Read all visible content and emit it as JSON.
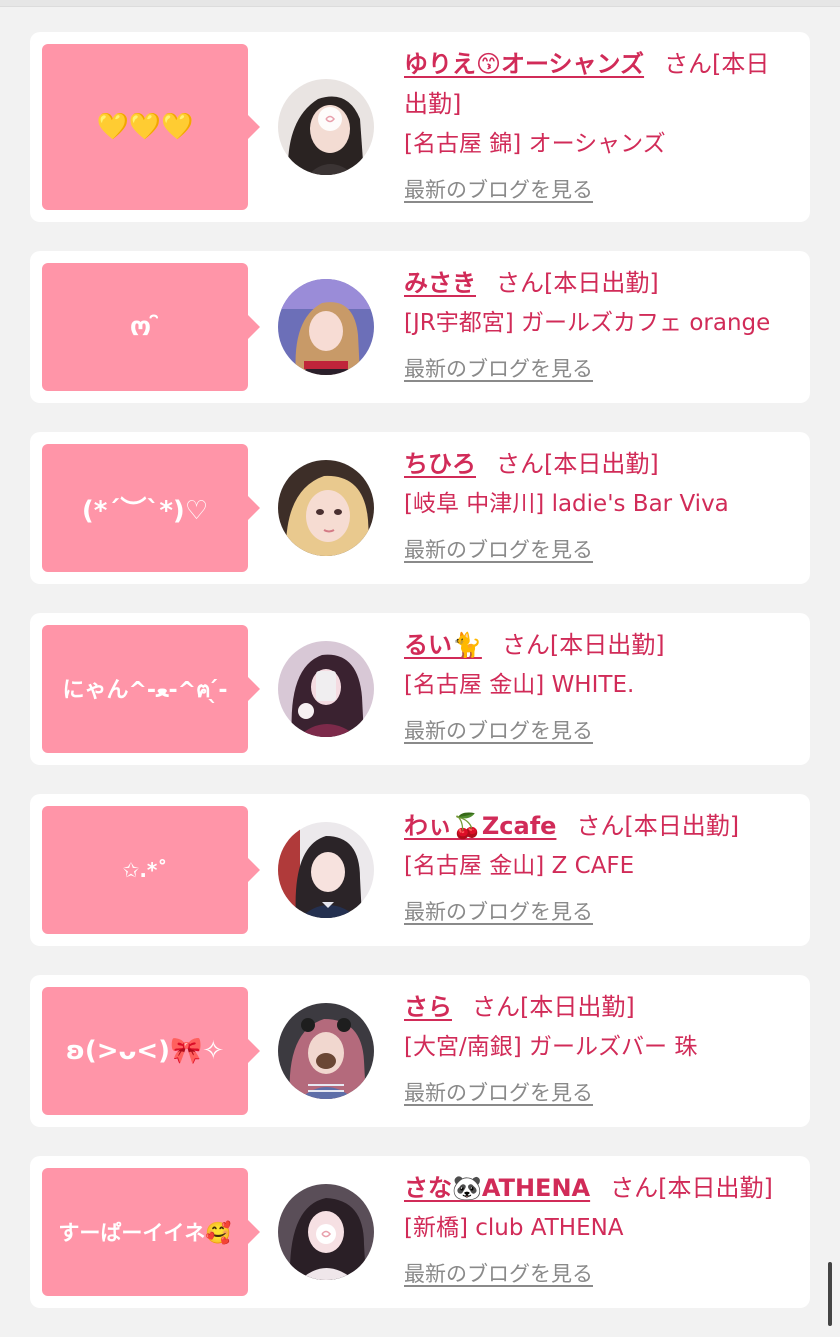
{
  "common": {
    "san_suffix": "さん[本日出勤]",
    "blog_link": "最新のブログを見る"
  },
  "entries": [
    {
      "bubble": "💛💛💛",
      "name": "ゆりえ😙オーシャンズ",
      "shop": "[名古屋 錦] オーシャンズ"
    },
    {
      "bubble": "ო ̑̑",
      "name": "みさき",
      "shop": "[JR宇都宮] ガールズカフェ orange"
    },
    {
      "bubble": "(*´︶`*)♡",
      "name": "ちひろ",
      "shop": "[岐阜 中津川] ladie's Bar Viva"
    },
    {
      "bubble": "にゃん^-ﻌ-^ฅ ̖́-",
      "name": "るい🐈",
      "shop": "[名古屋 金山] WHITE."
    },
    {
      "bubble": "✩.*˚",
      "name": "わぃ🍒Zcafe",
      "shop": "[名古屋 金山] Z CAFE"
    },
    {
      "bubble": "ʚ(>ᴗ<)🎀✧",
      "name": "さら",
      "shop": "[大宮/南銀] ガールズバー 珠"
    },
    {
      "bubble": "すーぱーイイネ🥰",
      "name": "さな🐼ATHENA",
      "shop": "[新橋] club ATHENA"
    }
  ]
}
